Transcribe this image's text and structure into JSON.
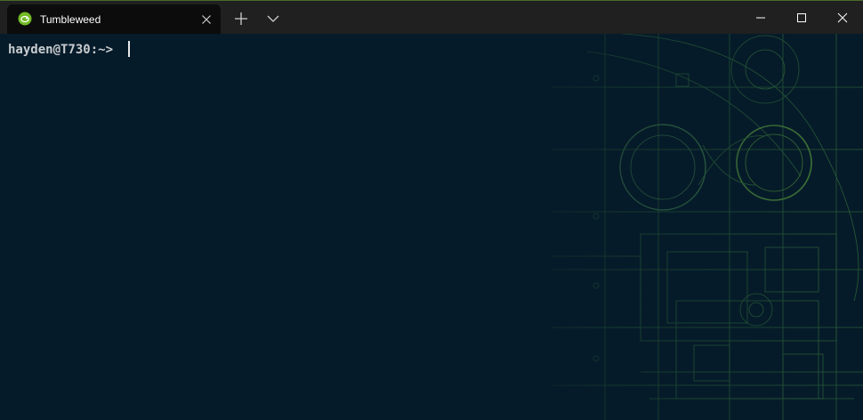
{
  "tab": {
    "title": "Tumbleweed",
    "icon": "opensuse-logo-icon"
  },
  "terminal": {
    "prompt": "hayden@T730:~> "
  },
  "colors": {
    "background": "#061b29",
    "titlebar": "#202020",
    "tab": "#0c0c0c",
    "accent_green": "#73ba25",
    "prompt_text": "#c8ccd0"
  }
}
